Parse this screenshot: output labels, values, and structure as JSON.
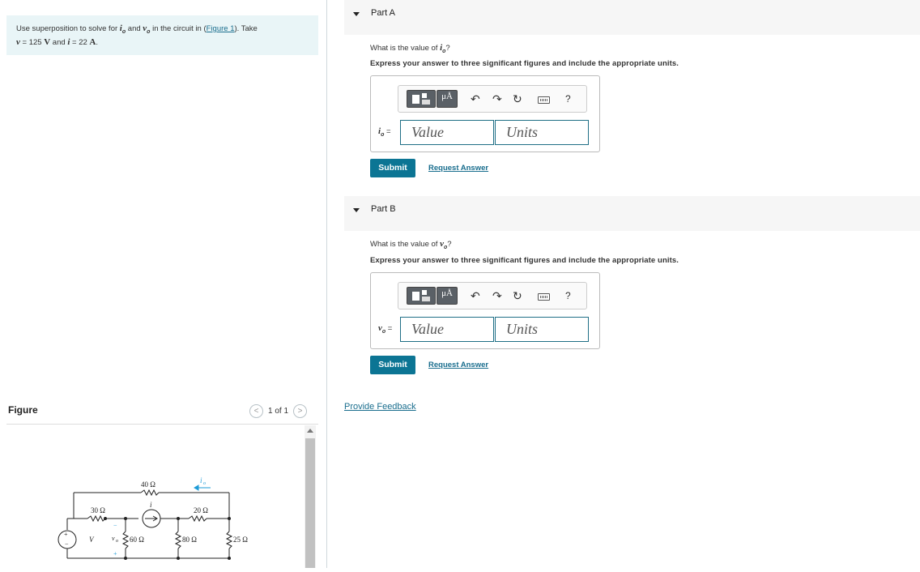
{
  "problem": {
    "prefix": "Use superposition to solve for ",
    "var_io": "i",
    "sub_o": "o",
    "and_text": " and ",
    "var_vo": "v",
    "suffix": " in the circuit in (",
    "figure_link": "Figure 1",
    "after_link": "). Take",
    "v_sym": "v",
    "v_eq": " = 125 ",
    "v_unit": "V",
    "and2": " and ",
    "i_sym": "i",
    "i_eq": " = 22 ",
    "i_unit": "A",
    "end": "."
  },
  "figure": {
    "title": "Figure",
    "pager": "1 of 1",
    "prev_glyph": "<",
    "next_glyph": ">",
    "circuit": {
      "r40": "40 Ω",
      "r30": "30 Ω",
      "r20": "20 Ω",
      "r60": "60 Ω",
      "r80": "80 Ω",
      "r25": "25 Ω",
      "src_v": "V",
      "src_i": "i",
      "cur_io": "i",
      "cur_io_sub": "o",
      "volt_vo": "v",
      "volt_vo_sub": "o",
      "minus": "−",
      "plus": "+",
      "src_plus": "+",
      "src_minus": "−"
    }
  },
  "partA": {
    "label": "Part A",
    "question_prefix": "What is the value of ",
    "question_var": "i",
    "question_sub": "o",
    "question_suffix": "?",
    "instruction": "Express your answer to three significant figures and include the appropriate units.",
    "eq_var": "i",
    "eq_sub": "o",
    "eq_sign": " =",
    "value_placeholder": "Value",
    "units_placeholder": "Units",
    "mu_label": "μÅ",
    "help": "?",
    "submit": "Submit",
    "request": "Request Answer"
  },
  "partB": {
    "label": "Part B",
    "question_prefix": "What is the value of ",
    "question_var": "v",
    "question_sub": "o",
    "question_suffix": "?",
    "instruction": "Express your answer to three significant figures and include the appropriate units.",
    "eq_var": "v",
    "eq_sub": "o",
    "eq_sign": " =",
    "value_placeholder": "Value",
    "units_placeholder": "Units",
    "mu_label": "μÅ",
    "help": "?",
    "submit": "Submit",
    "request": "Request Answer"
  },
  "feedback": "Provide Feedback",
  "colors": {
    "accent": "#0c7594",
    "link": "#1a6e8e",
    "current_arrow": "#1e9bd7"
  }
}
